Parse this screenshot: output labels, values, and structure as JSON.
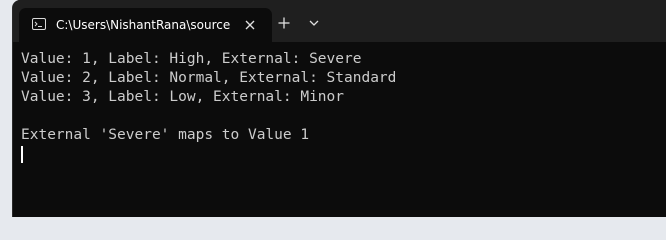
{
  "tab": {
    "title": "C:\\Users\\NishantRana\\source\\",
    "icon": "terminal-icon"
  },
  "controls": {
    "close_icon": "close-icon",
    "new_tab_icon": "plus-icon",
    "dropdown_icon": "chevron-down-icon"
  },
  "console": {
    "lines": [
      "Value: 1, Label: High, External: Severe",
      "Value: 2, Label: Normal, External: Standard",
      "Value: 3, Label: Low, External: Minor",
      "",
      "External 'Severe' maps to Value 1"
    ]
  }
}
